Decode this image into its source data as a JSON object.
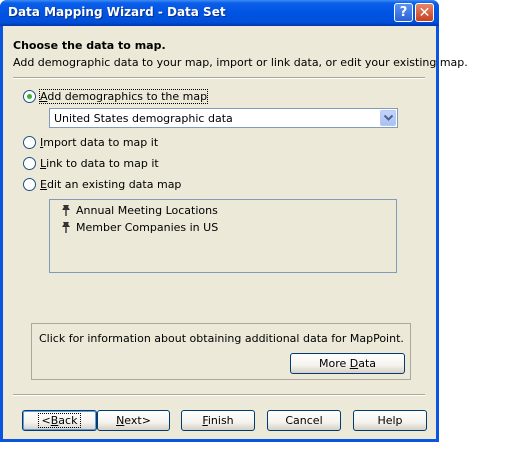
{
  "window": {
    "title": "Data Mapping Wizard - Data Set",
    "help_glyph": "?",
    "close_glyph": "✕"
  },
  "header": {
    "title": "Choose the data to map.",
    "subtitle": "Add demographic data to your map, import or link data, or edit your existing map."
  },
  "options": [
    {
      "accesskey": "A",
      "rest": "dd demographics to the map",
      "checked": true
    },
    {
      "accesskey": "I",
      "rest": "mport data to map it",
      "checked": false
    },
    {
      "accesskey": "L",
      "rest": "ink to data to map it",
      "checked": false
    },
    {
      "accesskey": "E",
      "rest": "dit an existing data map",
      "checked": false
    }
  ],
  "demographics_select": {
    "value": "United States demographic data"
  },
  "data_maps": [
    {
      "label": "Annual Meeting Locations",
      "icon": "pushpin-icon"
    },
    {
      "label": "Member Companies in US",
      "icon": "pushpin-icon"
    }
  ],
  "info": {
    "text": "Click for information about obtaining additional data for MapPoint.",
    "more_data": {
      "pre": "More ",
      "accesskey": "D",
      "post": "ata"
    }
  },
  "buttons": {
    "back": {
      "pre": "<",
      "accesskey": "B",
      "post": "ack"
    },
    "next": {
      "pre": "",
      "accesskey": "N",
      "post": "ext>"
    },
    "finish": {
      "pre": "",
      "accesskey": "F",
      "post": "inish"
    },
    "cancel": "Cancel",
    "help": "Help"
  },
  "colors": {
    "title_bar": "#0054e3",
    "dialog_face": "#ece9d8",
    "radio_dot": "#3cb037"
  }
}
